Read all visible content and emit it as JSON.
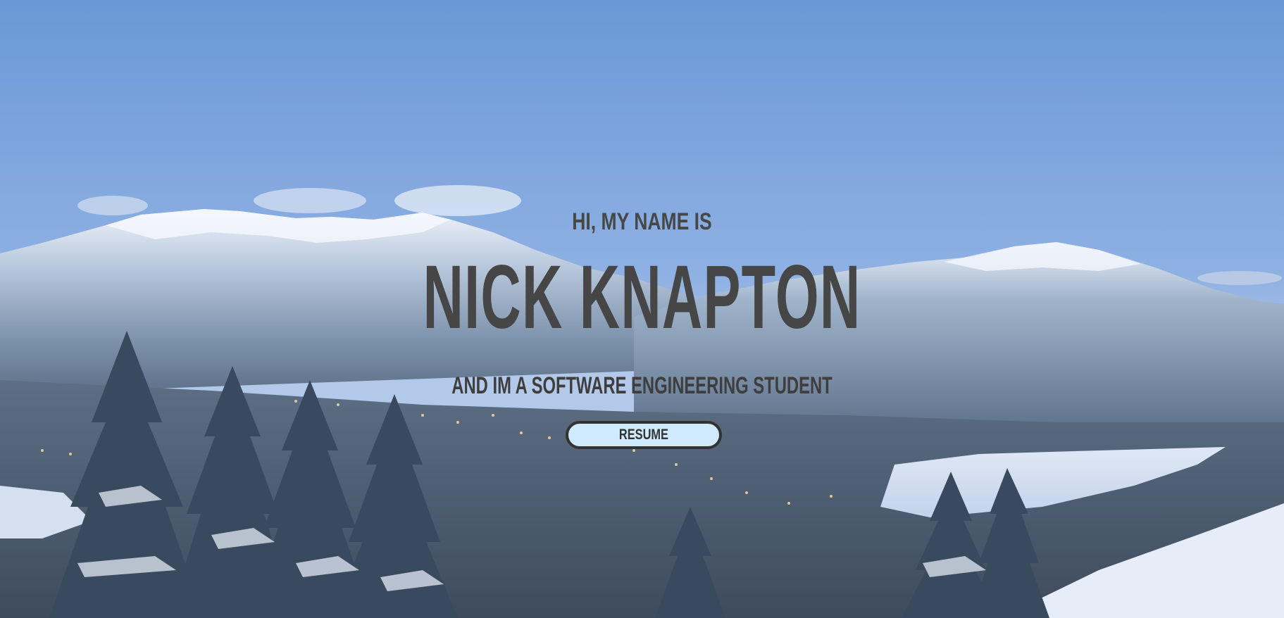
{
  "hero": {
    "greeting": "HI, MY NAME IS",
    "name": "NICK KNAPTON",
    "subtitle": "AND IM A SOFTWARE ENGINEERING STUDENT",
    "resume_label": "RESUME"
  },
  "colors": {
    "sky_top": "#6b9ad8",
    "text": "#464646",
    "button_bg": "#cfeafd",
    "button_border": "#333333"
  }
}
